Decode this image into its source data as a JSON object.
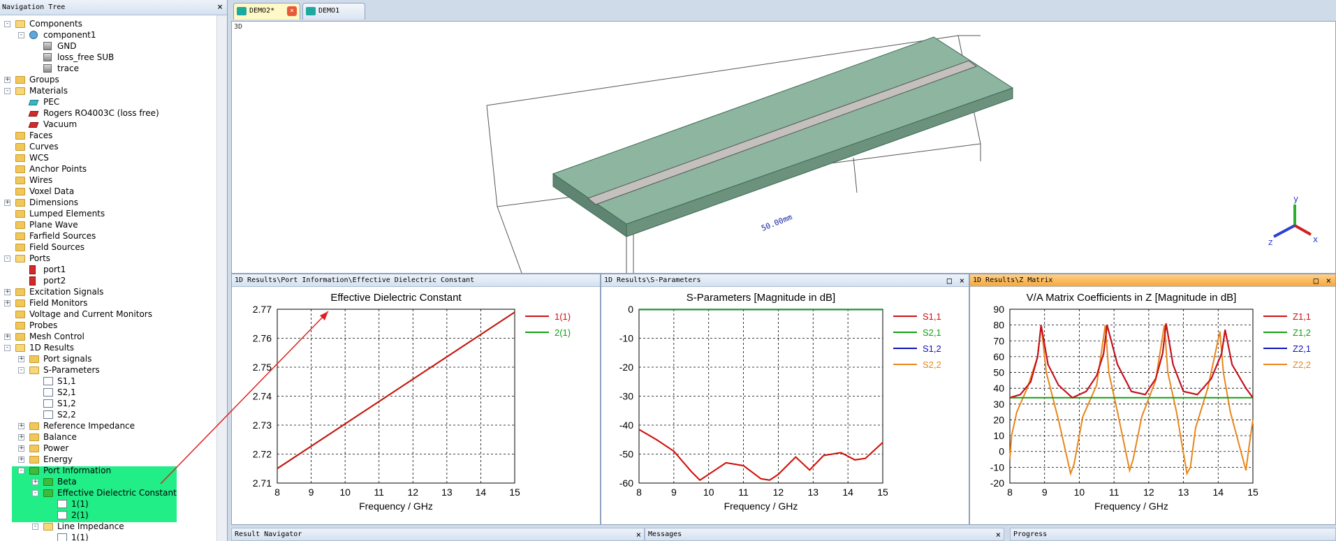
{
  "nav": {
    "title": "Navigation Tree",
    "close": "×",
    "items": [
      {
        "label": "Components",
        "pm": "-",
        "icon": "folder-open-icon",
        "ic": "folder open"
      },
      {
        "label": "component1",
        "pm": "-",
        "icon": "component-icon",
        "ic": "comp"
      },
      {
        "label": "GND",
        "pm": "",
        "icon": "solid-block-icon",
        "ic": "block"
      },
      {
        "label": "loss_free SUB",
        "pm": "",
        "icon": "solid-block-icon",
        "ic": "block"
      },
      {
        "label": "trace",
        "pm": "",
        "icon": "solid-block-icon",
        "ic": "block"
      },
      {
        "label": "Groups",
        "pm": "+",
        "icon": "folder-icon",
        "ic": "folder"
      },
      {
        "label": "Materials",
        "pm": "-",
        "icon": "folder-open-icon",
        "ic": "folder open"
      },
      {
        "label": "PEC",
        "pm": "",
        "icon": "material-pec-icon",
        "ic": "pec"
      },
      {
        "label": "Rogers RO4003C (loss free)",
        "pm": "",
        "icon": "material-icon",
        "ic": "mat"
      },
      {
        "label": "Vacuum",
        "pm": "",
        "icon": "material-icon",
        "ic": "mat"
      },
      {
        "label": "Faces",
        "pm": "",
        "icon": "folder-icon",
        "ic": "folder"
      },
      {
        "label": "Curves",
        "pm": "",
        "icon": "folder-icon",
        "ic": "folder"
      },
      {
        "label": "WCS",
        "pm": "",
        "icon": "folder-icon",
        "ic": "folder"
      },
      {
        "label": "Anchor Points",
        "pm": "",
        "icon": "folder-icon",
        "ic": "folder"
      },
      {
        "label": "Wires",
        "pm": "",
        "icon": "folder-icon",
        "ic": "folder"
      },
      {
        "label": "Voxel Data",
        "pm": "",
        "icon": "folder-icon",
        "ic": "folder"
      },
      {
        "label": "Dimensions",
        "pm": "+",
        "icon": "folder-icon",
        "ic": "folder"
      },
      {
        "label": "Lumped Elements",
        "pm": "",
        "icon": "folder-icon",
        "ic": "folder"
      },
      {
        "label": "Plane Wave",
        "pm": "",
        "icon": "folder-icon",
        "ic": "folder"
      },
      {
        "label": "Farfield Sources",
        "pm": "",
        "icon": "folder-icon",
        "ic": "folder"
      },
      {
        "label": "Field Sources",
        "pm": "",
        "icon": "folder-icon",
        "ic": "folder"
      },
      {
        "label": "Ports",
        "pm": "-",
        "icon": "folder-open-icon",
        "ic": "folder open"
      },
      {
        "label": "port1",
        "pm": "",
        "icon": "port-icon",
        "ic": "port"
      },
      {
        "label": "port2",
        "pm": "",
        "icon": "port-icon",
        "ic": "port"
      },
      {
        "label": "Excitation Signals",
        "pm": "+",
        "icon": "folder-icon",
        "ic": "folder"
      },
      {
        "label": "Field Monitors",
        "pm": "+",
        "icon": "folder-icon",
        "ic": "folder"
      },
      {
        "label": "Voltage and Current Monitors",
        "pm": "",
        "icon": "folder-icon",
        "ic": "folder"
      },
      {
        "label": "Probes",
        "pm": "",
        "icon": "folder-icon",
        "ic": "folder"
      },
      {
        "label": "Mesh Control",
        "pm": "+",
        "icon": "folder-icon",
        "ic": "folder"
      },
      {
        "label": "1D Results",
        "pm": "-",
        "icon": "results-folder-icon",
        "ic": "folder open"
      },
      {
        "label": "Port signals",
        "pm": "+",
        "icon": "folder-icon",
        "ic": "folder"
      },
      {
        "label": "S-Parameters",
        "pm": "-",
        "icon": "folder-open-icon",
        "ic": "folder open"
      },
      {
        "label": "S1,1",
        "pm": "",
        "icon": "result-curve-icon",
        "ic": "res"
      },
      {
        "label": "S2,1",
        "pm": "",
        "icon": "result-curve-icon",
        "ic": "res"
      },
      {
        "label": "S1,2",
        "pm": "",
        "icon": "result-curve-icon",
        "ic": "res"
      },
      {
        "label": "S2,2",
        "pm": "",
        "icon": "result-curve-icon",
        "ic": "res"
      },
      {
        "label": "Reference Impedance",
        "pm": "+",
        "icon": "folder-icon",
        "ic": "folder"
      },
      {
        "label": "Balance",
        "pm": "+",
        "icon": "folder-icon",
        "ic": "folder"
      },
      {
        "label": "Power",
        "pm": "+",
        "icon": "folder-icon",
        "ic": "folder"
      },
      {
        "label": "Energy",
        "pm": "+",
        "icon": "folder-icon",
        "ic": "folder"
      },
      {
        "label": "Port Information",
        "pm": "-",
        "icon": "folder-green-icon",
        "ic": "folder green"
      },
      {
        "label": "Beta",
        "pm": "+",
        "icon": "folder-green-icon",
        "ic": "folder green"
      },
      {
        "label": "Effective Dielectric Constant",
        "pm": "-",
        "icon": "folder-green-icon",
        "ic": "folder green"
      },
      {
        "label": "1(1)",
        "pm": "",
        "icon": "result-curve-icon",
        "ic": "res"
      },
      {
        "label": "2(1)",
        "pm": "",
        "icon": "result-curve-icon",
        "ic": "res"
      },
      {
        "label": "Line Impedance",
        "pm": "-",
        "icon": "folder-open-icon",
        "ic": "folder open"
      },
      {
        "label": "1(1)",
        "pm": "",
        "icon": "result-curve-icon",
        "ic": "res"
      }
    ]
  },
  "tabs": [
    {
      "label": "DEMO2*",
      "active": true
    },
    {
      "label": "DEMO1",
      "active": false
    }
  ],
  "view3d": {
    "label": "3D",
    "dimension": "50.00mm",
    "axes": {
      "x": "x",
      "y": "y",
      "z": "z"
    }
  },
  "panels": [
    {
      "header": "1D Results\\Port Information\\Effective Dielectric Constant"
    },
    {
      "header": "1D Results\\S-Parameters"
    },
    {
      "header": "1D Results\\Z Matrix"
    }
  ],
  "colors": {
    "accent_tab": "#fff9c8",
    "highlight": "#22ee88",
    "annotation": "#e02020"
  },
  "bottom": {
    "result_navigator": "Result Navigator",
    "messages": "Messages",
    "progress": "Progress"
  },
  "chart_data": [
    {
      "type": "line",
      "title": "Effective Dielectric Constant",
      "xlabel": "Frequency / GHz",
      "ylabel": "",
      "xlim": [
        8,
        15
      ],
      "ylim": [
        2.71,
        2.77
      ],
      "xticks": [
        8,
        9,
        10,
        11,
        12,
        13,
        14,
        15
      ],
      "yticks": [
        2.71,
        2.72,
        2.73,
        2.74,
        2.75,
        2.76,
        2.77
      ],
      "grid": true,
      "legend": "right",
      "series": [
        {
          "name": "1(1)",
          "color": "#d01010",
          "x": [
            8,
            15
          ],
          "y": [
            2.715,
            2.769
          ]
        },
        {
          "name": "2(1)",
          "color": "#10a010",
          "x": [
            8,
            15
          ],
          "y": [
            2.715,
            2.769
          ]
        }
      ]
    },
    {
      "type": "line",
      "title": "S-Parameters [Magnitude in dB]",
      "xlabel": "Frequency / GHz",
      "ylabel": "",
      "xlim": [
        8,
        15
      ],
      "ylim": [
        -60,
        0
      ],
      "xticks": [
        8,
        9,
        10,
        11,
        12,
        13,
        14,
        15
      ],
      "yticks": [
        0,
        -10,
        -20,
        -30,
        -40,
        -50,
        -60
      ],
      "grid": true,
      "legend": "right",
      "series": [
        {
          "name": "S1,1",
          "color": "#d01010",
          "x": [
            8,
            8.5,
            9,
            9.5,
            9.75,
            10,
            10.5,
            11,
            11.5,
            11.75,
            12,
            12.5,
            12.9,
            13.3,
            13.8,
            14.2,
            14.5,
            15
          ],
          "y": [
            -41.5,
            -45,
            -49,
            -56,
            -59,
            -57,
            -53,
            -54,
            -58.5,
            -59,
            -57,
            -51,
            -55.5,
            -50.5,
            -49.5,
            -52,
            -51.5,
            -46
          ]
        },
        {
          "name": "S2,1",
          "color": "#10a010",
          "x": [
            8,
            15
          ],
          "y": [
            -0.1,
            -0.1
          ]
        },
        {
          "name": "S1,2",
          "color": "#1010c0",
          "x": [
            8,
            15
          ],
          "y": [
            -0.1,
            -0.1
          ]
        },
        {
          "name": "S2,2",
          "color": "#e8861a",
          "x": [
            8,
            8.5,
            9,
            9.5,
            9.75,
            10,
            10.5,
            11,
            11.5,
            11.75,
            12,
            12.5,
            12.9,
            13.3,
            13.8,
            14.2,
            14.5,
            15
          ],
          "y": [
            -41.5,
            -45,
            -49,
            -56,
            -59,
            -57,
            -53,
            -54,
            -58.5,
            -59,
            -57,
            -51,
            -55.5,
            -50.5,
            -49.5,
            -52,
            -51.5,
            -46
          ]
        }
      ]
    },
    {
      "type": "line",
      "title": "V/A Matrix Coefficients in Z [Magnitude in dB]",
      "xlabel": "Frequency / GHz",
      "ylabel": "",
      "xlim": [
        8,
        15
      ],
      "ylim": [
        -20,
        90
      ],
      "xticks": [
        8,
        9,
        10,
        11,
        12,
        13,
        14,
        15
      ],
      "yticks": [
        90,
        80,
        70,
        60,
        50,
        40,
        30,
        20,
        10,
        0,
        -10,
        -20
      ],
      "grid": true,
      "legend": "right",
      "series": [
        {
          "name": "Z1,1",
          "color": "#d01010",
          "x": [
            8,
            8.3,
            8.6,
            8.8,
            8.9,
            9.1,
            9.4,
            9.8,
            10.2,
            10.5,
            10.7,
            10.8,
            11.1,
            11.5,
            11.9,
            12.2,
            12.4,
            12.5,
            12.7,
            13,
            13.4,
            13.8,
            14.1,
            14.2,
            14.4,
            14.8,
            15
          ],
          "y": [
            34,
            36,
            44,
            60,
            80,
            55,
            42,
            34,
            38,
            48,
            62,
            80,
            55,
            38,
            36,
            46,
            62,
            81,
            55,
            38,
            36,
            46,
            62,
            77,
            55,
            40,
            34
          ]
        },
        {
          "name": "Z1,2",
          "color": "#10a010",
          "x": [
            8,
            15
          ],
          "y": [
            34,
            34
          ]
        },
        {
          "name": "Z2,1",
          "color": "#1010c0",
          "x": [
            8,
            8.3,
            8.6,
            8.8,
            8.9,
            9.1,
            9.4,
            9.8,
            10.2,
            10.5,
            10.7,
            10.8,
            11.1,
            11.5,
            11.9,
            12.2,
            12.4,
            12.5,
            12.7,
            13,
            13.4,
            13.8,
            14.1,
            14.2,
            14.4,
            14.8,
            15
          ],
          "y": [
            34,
            36,
            44,
            60,
            80,
            55,
            42,
            34,
            38,
            48,
            62,
            80,
            55,
            38,
            36,
            46,
            62,
            81,
            55,
            38,
            36,
            46,
            62,
            77,
            55,
            40,
            34
          ]
        },
        {
          "name": "Z2,2",
          "color": "#e8861a",
          "x": [
            8,
            8.05,
            8.2,
            8.5,
            8.8,
            8.9,
            9.05,
            9.4,
            9.75,
            9.85,
            10.1,
            10.5,
            10.75,
            10.85,
            11.1,
            11.45,
            11.55,
            11.8,
            12.2,
            12.45,
            12.55,
            12.8,
            13.1,
            13.2,
            13.35,
            13.7,
            14.05,
            14.15,
            14.35,
            14.8,
            14.87,
            15
          ],
          "y": [
            -5,
            10,
            25,
            40,
            60,
            80,
            50,
            20,
            -14,
            -8,
            22,
            42,
            80,
            50,
            25,
            -12,
            -5,
            22,
            45,
            80,
            50,
            25,
            -14,
            -10,
            15,
            40,
            76,
            50,
            25,
            -12,
            0,
            20
          ]
        }
      ]
    }
  ]
}
